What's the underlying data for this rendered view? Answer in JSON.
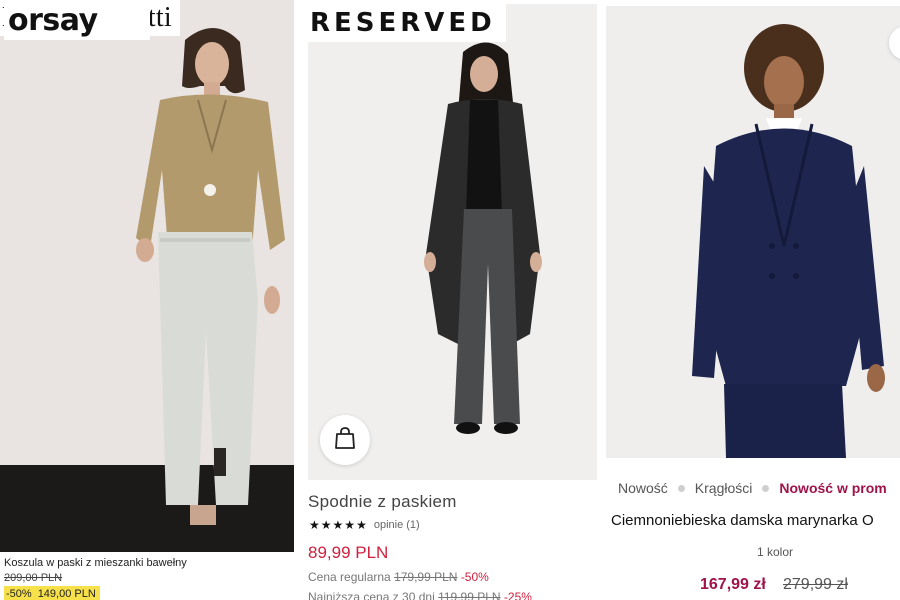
{
  "panels": [
    {
      "brand": "Massimo Dutti",
      "product_name": "Koszula w paski z mieszanki bawełny",
      "old_price": "209,00 PLN",
      "discount": "-50%",
      "price": "149,00 PLN"
    },
    {
      "brand": "RESERVED",
      "product_name": "Spodnie z paskiem",
      "rating_stars": 5,
      "reviews": "opinie (1)",
      "price": "89,99 PLN",
      "regular_label": "Cena regularna",
      "regular_price": "179,99 PLN",
      "regular_discount": "-50%",
      "lowest_label": "Najniższa cena z 30 dni",
      "lowest_price": "119,99 PLN",
      "lowest_discount": "-25%"
    },
    {
      "brand": "orsay",
      "tags": [
        "Nowość",
        "Krągłości",
        "Nowość w prom"
      ],
      "product_name": "Ciemnoniebieska damska marynarka O",
      "colors": "1 kolor",
      "price": "167,99 zł",
      "old_price": "279,99 zł"
    }
  ],
  "colors": {
    "sale_red": "#d0203e",
    "orsay_magenta": "#a0124a",
    "badge_yellow": "#f6e14a"
  },
  "icons": [
    "shopping-bag-icon",
    "star-icon"
  ]
}
